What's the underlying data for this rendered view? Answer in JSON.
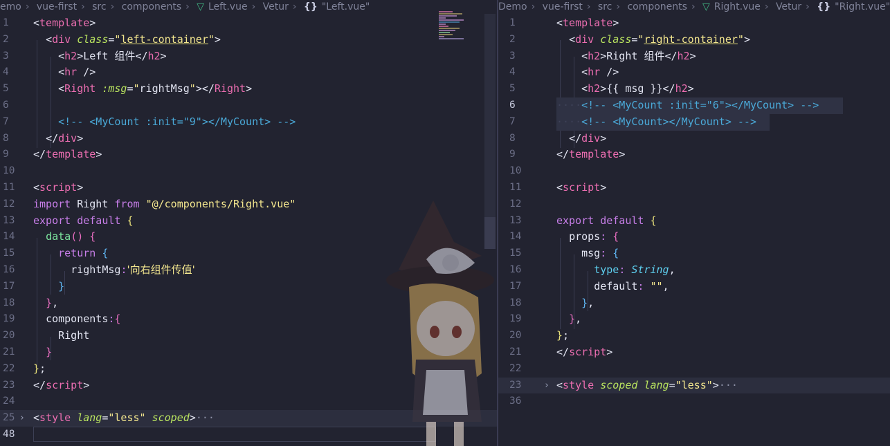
{
  "left": {
    "breadcrumb": {
      "project": "emo",
      "folder1": "vue-first",
      "folder2": "src",
      "folder3": "components",
      "file": "Left.vue",
      "lang": "Vetur",
      "symbol": "\"Left.vue\""
    },
    "line_numbers": [
      "1",
      "2",
      "3",
      "4",
      "5",
      "6",
      "7",
      "8",
      "9",
      "10",
      "11",
      "12",
      "13",
      "14",
      "15",
      "16",
      "17",
      "18",
      "19",
      "20",
      "21",
      "22",
      "23",
      "24",
      "25",
      "48"
    ],
    "code": {
      "l1": "template",
      "l2_tag": "div",
      "l2_attr": "class",
      "l2_val": "left-container",
      "l3_tag": "h2",
      "l3_text": "Left ",
      "l3_cn": "组件",
      "l4_tag": "hr",
      "l5_tag": "Right",
      "l5_attr": ":msg",
      "l5_val": "rightMsg",
      "l7_comment": "<!-- <MyCount :init=\"9\"></MyCount> -->",
      "l8_tag": "div",
      "l9_tag": "template",
      "l11_tag": "script",
      "l12_import": "import",
      "l12_name": "Right",
      "l12_from": "from",
      "l12_path": "\"@/components/Right.vue\"",
      "l13_export": "export",
      "l13_default": "default",
      "l14_fn": "data",
      "l15_return": "return",
      "l16_key": "rightMsg",
      "l16_val": "'向右组件传值'",
      "l19_key": "components",
      "l20_name": "Right",
      "l23_tag": "script",
      "l25_tag": "style",
      "l25_attr1": "lang",
      "l25_val1": "\"less\"",
      "l25_attr2": "scoped",
      "fold_dots": "···"
    }
  },
  "right": {
    "breadcrumb": {
      "project": "Demo",
      "folder1": "vue-first",
      "folder2": "src",
      "folder3": "components",
      "file": "Right.vue",
      "lang": "Vetur",
      "symbol": "\"Right.vue\""
    },
    "line_numbers": [
      "1",
      "2",
      "3",
      "4",
      "5",
      "6",
      "7",
      "8",
      "9",
      "10",
      "11",
      "12",
      "13",
      "14",
      "15",
      "16",
      "17",
      "18",
      "19",
      "20",
      "21",
      "22",
      "23",
      "36"
    ],
    "code": {
      "l1": "template",
      "l2_tag": "div",
      "l2_attr": "class",
      "l2_val": "right-container",
      "l3_tag": "h2",
      "l3_text": "Right ",
      "l3_cn": "组件",
      "l4_tag": "hr",
      "l5_tag": "h2",
      "l5_text": "{{ msg }}",
      "l6_comment": "<!-- <MyCount :init=\"6\"></MyCount> -->",
      "l7_comment": "<!-- <MyCount></MyCount> -->",
      "l8_tag": "div",
      "l9_tag": "template",
      "l11_tag": "script",
      "l13_export": "export",
      "l13_default": "default",
      "l14_key": "props",
      "l15_key": "msg",
      "l16_key": "type",
      "l16_val": "String",
      "l17_key": "default",
      "l17_val": "\"\"",
      "l23_tag": "style",
      "l23_attr1": "scoped",
      "l23_attr2": "lang",
      "l23_val2": "\"less\"",
      "fold_dots": "···"
    }
  },
  "colors": {
    "background": "#222330",
    "tag": "#ec6eb1",
    "attribute": "#b9e35f",
    "string": "#f3e68e",
    "keyword": "#c77ee8",
    "comment": "#4aa9d8",
    "vue_brand": "#41b883"
  }
}
